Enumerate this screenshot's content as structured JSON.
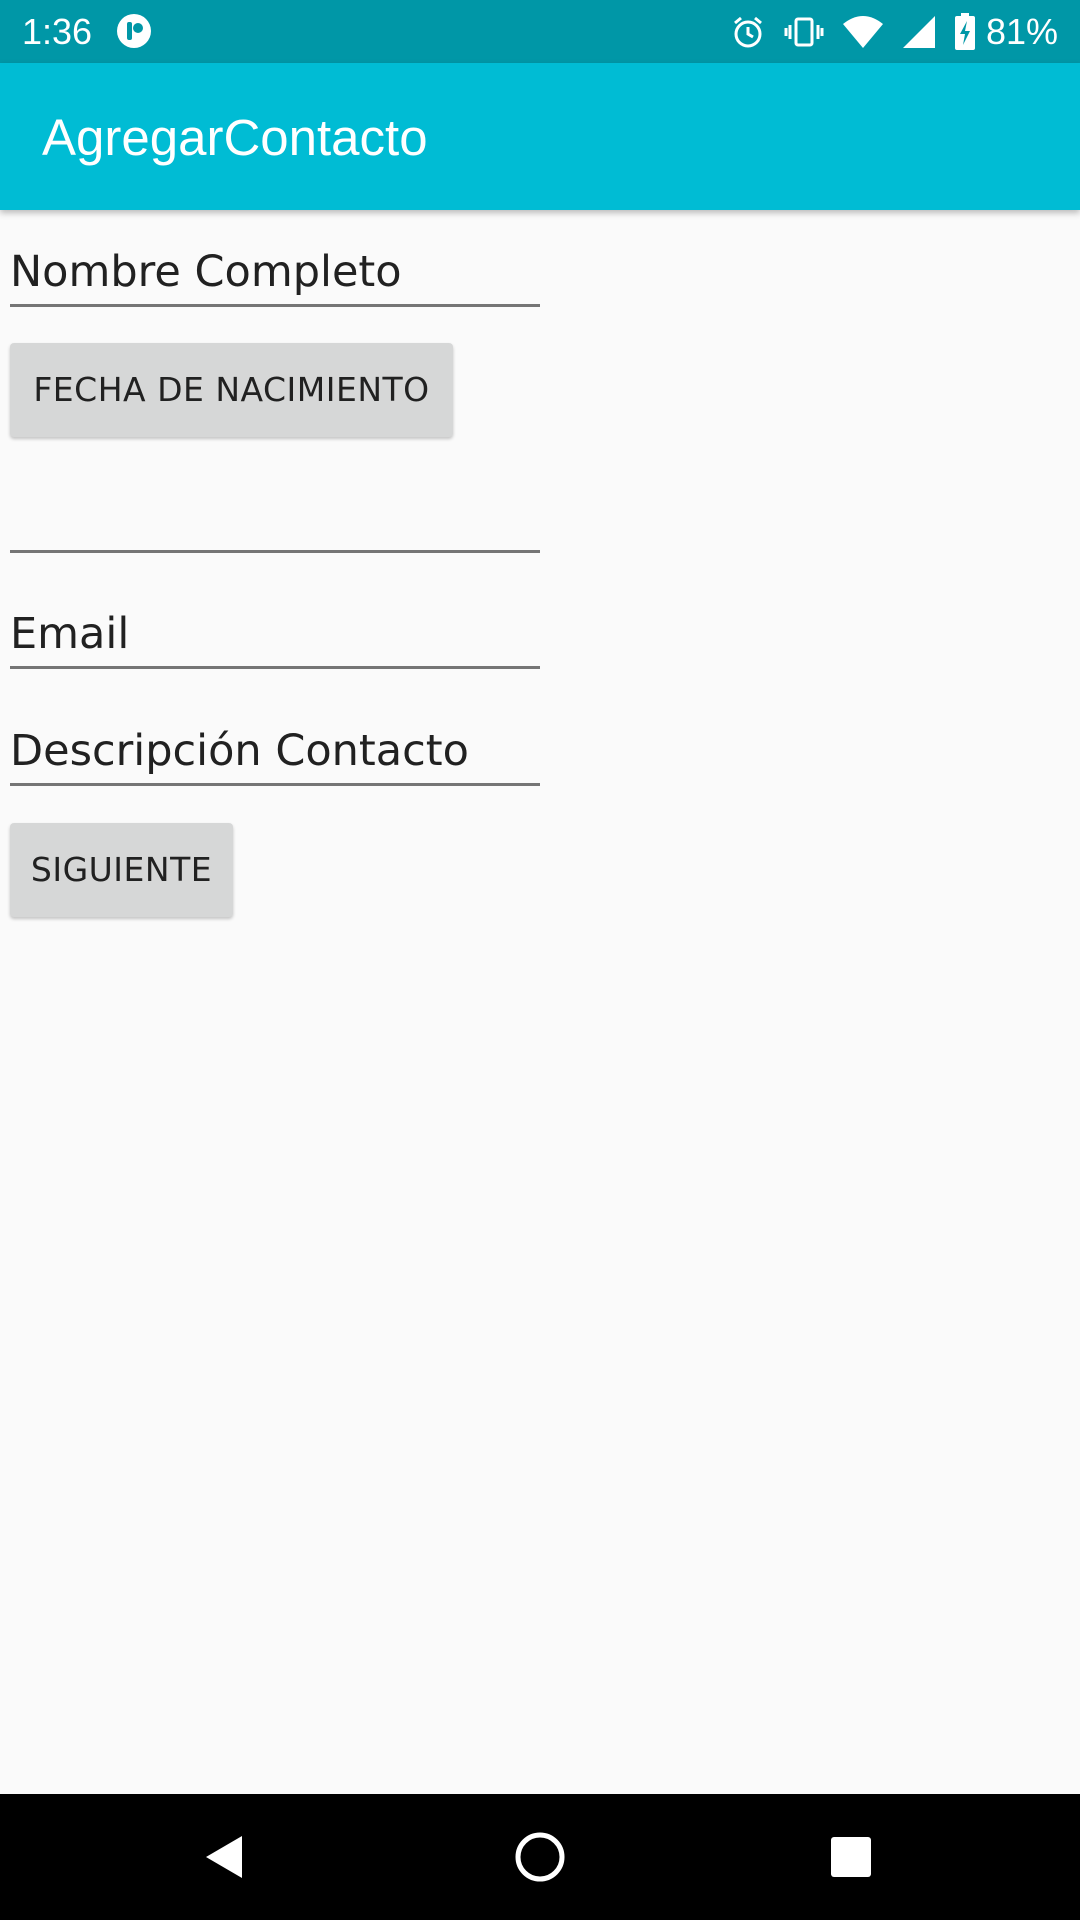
{
  "status_bar": {
    "time": "1:36",
    "battery_percent": "81%",
    "icons": [
      "app-notification-icon",
      "alarm-icon",
      "vibrate-icon",
      "wifi-icon",
      "cell-signal-icon",
      "battery-charging-icon"
    ]
  },
  "app_bar": {
    "title": "AgregarContacto",
    "color": "#00bcd4"
  },
  "form": {
    "nombre_placeholder": "Nombre Completo",
    "fecha_button_label": "FECHA DE NACIMIENTO",
    "fecha_value": "",
    "email_placeholder": "Email",
    "descripcion_placeholder": "Descripción Contacto",
    "siguiente_button_label": "SIGUIENTE"
  },
  "nav_bar": {
    "icons": [
      "back-icon",
      "home-icon",
      "recents-icon"
    ]
  },
  "colors": {
    "status_bar": "#0097a7",
    "app_bar": "#00bcd4",
    "background": "#fafafa",
    "button": "#d6d7d7",
    "underline": "#757575"
  }
}
